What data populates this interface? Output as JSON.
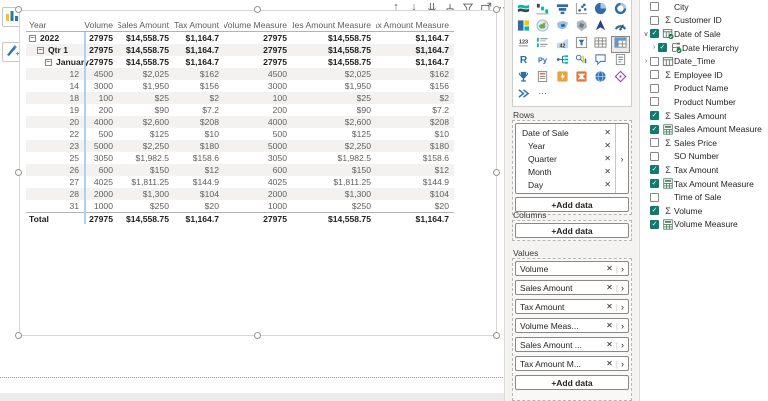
{
  "theme": {
    "accent_check": "#0f7b6f",
    "band_gray": "#f3f2f1",
    "freeze_blue": "#aad2f2",
    "header_text": "#605e5c"
  },
  "left_rail": {
    "icons": [
      "bar-chart-icon",
      "paintbrush-icon"
    ]
  },
  "visual_header": {
    "icons": [
      "drill-up",
      "drill-down",
      "expand-next-level",
      "expand-all-down",
      "filter",
      "focus-mode",
      "more-options"
    ]
  },
  "matrix": {
    "columns": [
      "Year",
      "Volume",
      "Sales Amount",
      "Tax Amount",
      "Volume Measure",
      "Sales Amount Measure",
      "Tax Amount Measure"
    ],
    "rows": [
      {
        "label": "2022",
        "level": 0,
        "bold": true,
        "collapse": true,
        "numeric": false,
        "values": [
          "27975",
          "$14,558.75",
          "$1,164.7",
          "27975",
          "$14,558.75",
          "$1,164.7"
        ]
      },
      {
        "label": "Qtr 1",
        "level": 1,
        "bold": true,
        "collapse": true,
        "numeric": false,
        "values": [
          "27975",
          "$14,558.75",
          "$1,164.7",
          "27975",
          "$14,558.75",
          "$1,164.7"
        ]
      },
      {
        "label": "January",
        "level": 2,
        "bold": true,
        "collapse": true,
        "numeric": false,
        "values": [
          "27975",
          "$14,558.75",
          "$1,164.7",
          "27975",
          "$14,558.75",
          "$1,164.7"
        ]
      },
      {
        "label": "12",
        "level": 3,
        "bold": false,
        "collapse": false,
        "numeric": true,
        "values": [
          "4500",
          "$2,025",
          "$162",
          "4500",
          "$2,025",
          "$162"
        ]
      },
      {
        "label": "14",
        "level": 3,
        "bold": false,
        "collapse": false,
        "numeric": true,
        "values": [
          "3000",
          "$1,950",
          "$156",
          "3000",
          "$1,950",
          "$156"
        ]
      },
      {
        "label": "18",
        "level": 3,
        "bold": false,
        "collapse": false,
        "numeric": true,
        "values": [
          "100",
          "$25",
          "$2",
          "100",
          "$25",
          "$2"
        ]
      },
      {
        "label": "19",
        "level": 3,
        "bold": false,
        "collapse": false,
        "numeric": true,
        "values": [
          "200",
          "$90",
          "$7.2",
          "200",
          "$90",
          "$7.2"
        ]
      },
      {
        "label": "20",
        "level": 3,
        "bold": false,
        "collapse": false,
        "numeric": true,
        "values": [
          "4000",
          "$2,600",
          "$208",
          "4000",
          "$2,600",
          "$208"
        ]
      },
      {
        "label": "22",
        "level": 3,
        "bold": false,
        "collapse": false,
        "numeric": true,
        "values": [
          "500",
          "$125",
          "$10",
          "500",
          "$125",
          "$10"
        ]
      },
      {
        "label": "23",
        "level": 3,
        "bold": false,
        "collapse": false,
        "numeric": true,
        "values": [
          "5000",
          "$2,250",
          "$180",
          "5000",
          "$2,250",
          "$180"
        ]
      },
      {
        "label": "25",
        "level": 3,
        "bold": false,
        "collapse": false,
        "numeric": true,
        "values": [
          "3050",
          "$1,982.5",
          "$158.6",
          "3050",
          "$1,982.5",
          "$158.6"
        ]
      },
      {
        "label": "26",
        "level": 3,
        "bold": false,
        "collapse": false,
        "numeric": true,
        "values": [
          "600",
          "$150",
          "$12",
          "600",
          "$150",
          "$12"
        ]
      },
      {
        "label": "27",
        "level": 3,
        "bold": false,
        "collapse": false,
        "numeric": true,
        "values": [
          "4025",
          "$1,811.25",
          "$144.9",
          "4025",
          "$1,811.25",
          "$144.9"
        ]
      },
      {
        "label": "28",
        "level": 3,
        "bold": false,
        "collapse": false,
        "numeric": true,
        "values": [
          "2000",
          "$1,300",
          "$104",
          "2000",
          "$1,300",
          "$104"
        ]
      },
      {
        "label": "31",
        "level": 3,
        "bold": false,
        "collapse": false,
        "numeric": true,
        "values": [
          "1000",
          "$250",
          "$20",
          "1000",
          "$250",
          "$20"
        ]
      },
      {
        "label": "Total",
        "level": 0,
        "bold": true,
        "collapse": false,
        "numeric": false,
        "total": true,
        "values": [
          "27975",
          "$14,558.75",
          "$1,164.7",
          "27975",
          "$14,558.75",
          "$1,164.7"
        ]
      }
    ]
  },
  "viz_pane": {
    "gallery": {
      "icons": [
        "ribbon-chart",
        "waterfall-chart",
        "funnel-chart",
        "scatter-chart",
        "pie-chart",
        "donut-chart",
        "treemap",
        "map",
        "filled-map",
        "shape-map",
        "arcgis-map",
        "gauge",
        "card",
        "multi-row-card",
        "kpi",
        "slicer",
        "table",
        "matrix",
        "r-script",
        "python-visual",
        "decomposition-tree",
        "key-influencers",
        "qa-visual",
        "smart-narrative",
        "metrics",
        "paginated-report",
        "power-apps",
        "power-automate",
        "globe-visual",
        "custom-visual",
        "streaming-visual",
        "more-visuals"
      ],
      "selected": "matrix"
    },
    "rows_label": "Rows",
    "rows_fields": [
      {
        "name": "Date of Sale",
        "child": false
      },
      {
        "name": "Year",
        "child": true
      },
      {
        "name": "Quarter",
        "child": true
      },
      {
        "name": "Month",
        "child": true
      },
      {
        "name": "Day",
        "child": true
      }
    ],
    "columns_label": "Columns",
    "values_label": "Values",
    "values_fields": [
      "Volume",
      "Sales Amount",
      "Tax Amount",
      "Volume Meas...",
      "Sales Amount ...",
      "Tax Amount M..."
    ],
    "add_data_label": "+Add data",
    "remove_glyph": "✕",
    "chevron_glyph": "›"
  },
  "fields_pane": {
    "items": [
      {
        "label": "City",
        "checked": false,
        "icon": "none",
        "chevron": "",
        "indent": false
      },
      {
        "label": "Customer ID",
        "checked": false,
        "icon": "sigma",
        "chevron": "",
        "indent": false
      },
      {
        "label": "Date of Sale",
        "checked": true,
        "icon": "date-table",
        "chevron": "v",
        "indent": false
      },
      {
        "label": "Date Hierarchy",
        "checked": true,
        "icon": "hierarchy",
        "chevron": ">",
        "indent": true
      },
      {
        "label": "Date_Time",
        "checked": false,
        "icon": "table-field",
        "chevron": ">",
        "indent": false
      },
      {
        "label": "Employee ID",
        "checked": false,
        "icon": "sigma",
        "chevron": "",
        "indent": false
      },
      {
        "label": "Product Name",
        "checked": false,
        "icon": "none",
        "chevron": "",
        "indent": false
      },
      {
        "label": "Product Number",
        "checked": false,
        "icon": "none",
        "chevron": "",
        "indent": false
      },
      {
        "label": "Sales Amount",
        "checked": true,
        "icon": "sigma",
        "chevron": "",
        "indent": false
      },
      {
        "label": "Sales Amount Measure",
        "checked": true,
        "icon": "calculator",
        "chevron": "",
        "indent": false
      },
      {
        "label": "Sales Price",
        "checked": false,
        "icon": "sigma",
        "chevron": "",
        "indent": false
      },
      {
        "label": "SO Number",
        "checked": false,
        "icon": "none",
        "chevron": "",
        "indent": false
      },
      {
        "label": "Tax Amount",
        "checked": true,
        "icon": "sigma",
        "chevron": "",
        "indent": false
      },
      {
        "label": "Tax Amount Measure",
        "checked": true,
        "icon": "calculator",
        "chevron": "",
        "indent": false
      },
      {
        "label": "Time of Sale",
        "checked": false,
        "icon": "none",
        "chevron": "",
        "indent": false
      },
      {
        "label": "Volume",
        "checked": true,
        "icon": "sigma",
        "chevron": "",
        "indent": false
      },
      {
        "label": "Volume Measure",
        "checked": true,
        "icon": "calculator",
        "chevron": "",
        "indent": false
      }
    ],
    "check_glyph": "✓"
  }
}
